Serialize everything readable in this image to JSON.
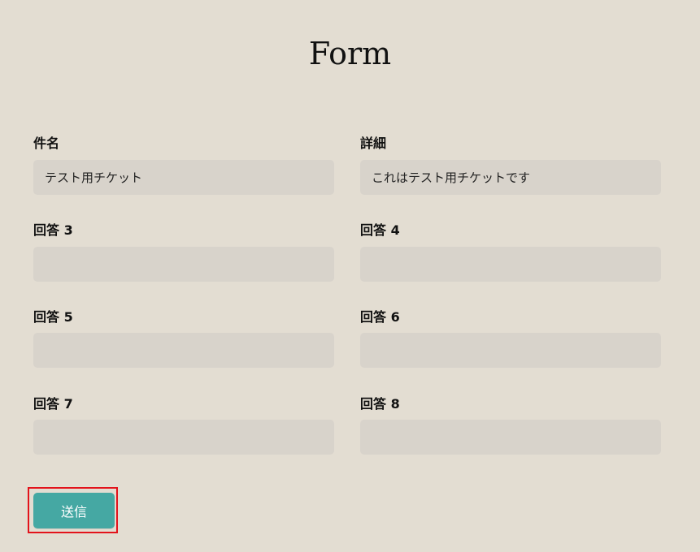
{
  "page": {
    "title": "Form"
  },
  "form": {
    "fields": [
      {
        "label": "件名",
        "value": "テスト用チケット",
        "placeholder": ""
      },
      {
        "label": "詳細",
        "value": "これはテスト用チケットです",
        "placeholder": ""
      },
      {
        "label": "回答 3",
        "value": "",
        "placeholder": ""
      },
      {
        "label": "回答 4",
        "value": "",
        "placeholder": ""
      },
      {
        "label": "回答 5",
        "value": "",
        "placeholder": ""
      },
      {
        "label": "回答 6",
        "value": "",
        "placeholder": ""
      },
      {
        "label": "回答 7",
        "value": "",
        "placeholder": ""
      },
      {
        "label": "回答 8",
        "value": "",
        "placeholder": ""
      }
    ],
    "submit_label": "送信"
  },
  "colors": {
    "background": "#e3ddd2",
    "input_background": "#d8d3cb",
    "button_background": "#45a8a3",
    "focus_ring": "#e3131b"
  }
}
